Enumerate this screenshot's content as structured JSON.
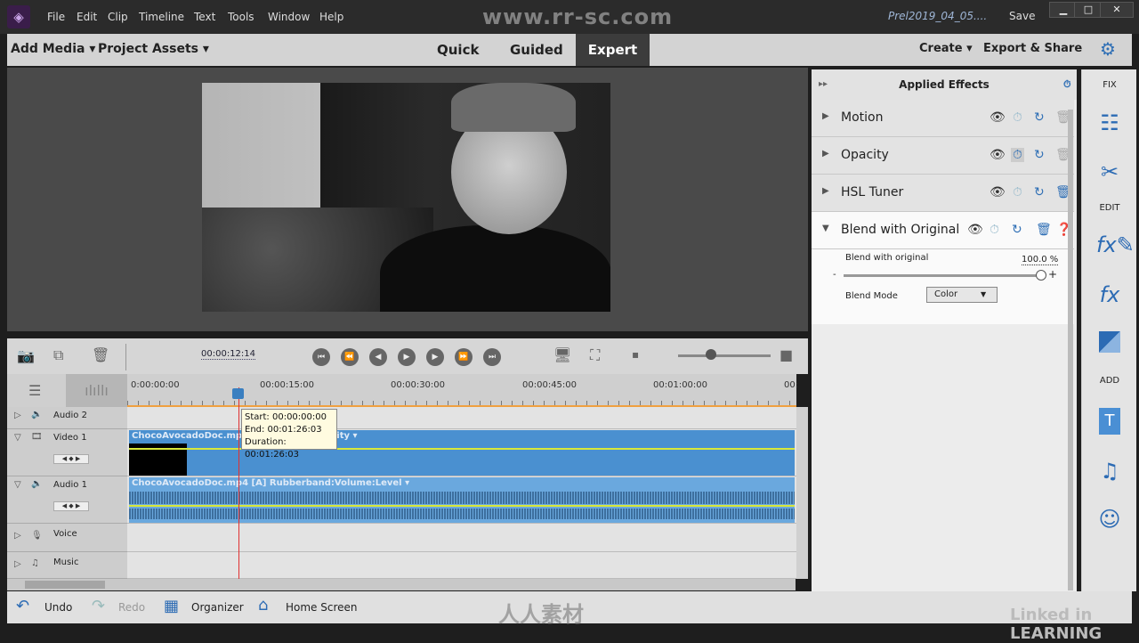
{
  "menubar": {
    "items": [
      "File",
      "Edit",
      "Clip",
      "Timeline",
      "Text",
      "Tools",
      "Window",
      "Help"
    ],
    "project": "Prel2019_04_05....",
    "save": "Save",
    "watermark": "www.rr-sc.com"
  },
  "toolbar": {
    "add_media": "Add Media ▾",
    "project_assets": "Project Assets ▾",
    "modes": [
      "Quick",
      "Guided",
      "Expert"
    ],
    "active_mode": "Expert",
    "create": "Create ▾",
    "export": "Export & Share"
  },
  "timeline": {
    "timecode": "00:00:12:14",
    "ruler": [
      "0:00:00:00",
      "00:00:15:00",
      "00:00:30:00",
      "00:00:45:00",
      "00:01:00:00",
      "00:"
    ],
    "tracks": [
      {
        "name": "Audio 2"
      },
      {
        "name": "Video 1"
      },
      {
        "name": "Audio 1"
      },
      {
        "name": "Voice"
      },
      {
        "name": "Music"
      }
    ],
    "video_clip": "ChocoAvocadoDoc.mp4 [V] Opacity:Opacity ▾",
    "audio_clip": "ChocoAvocadoDoc.mp4 [A] Rubberband:Volume:Level ▾",
    "tooltip": {
      "start": "Start: 00:00:00:00",
      "end": "End: 00:01:26:03",
      "duration": "Duration: 00:01:26:03"
    }
  },
  "panel": {
    "title": "Applied Effects",
    "effects": [
      {
        "name": "Motion"
      },
      {
        "name": "Opacity"
      },
      {
        "name": "HSL Tuner"
      },
      {
        "name": "Blend with Original",
        "expanded": true
      }
    ],
    "blend": {
      "label": "Blend with original",
      "value": "100.0 %",
      "percent": 100,
      "mode_label": "Blend Mode",
      "mode": "Color"
    }
  },
  "sidebar": {
    "fix": "FIX",
    "edit": "EDIT",
    "add": "ADD"
  },
  "bottom": {
    "undo": "Undo",
    "redo": "Redo",
    "organizer": "Organizer",
    "home": "Home Screen",
    "logo": "人人素材",
    "linkedin": "Linked in LEARNING"
  },
  "colors": {
    "accent": "#2f6fb5",
    "clip": "#4a90d0",
    "playhead": "#e03030"
  }
}
